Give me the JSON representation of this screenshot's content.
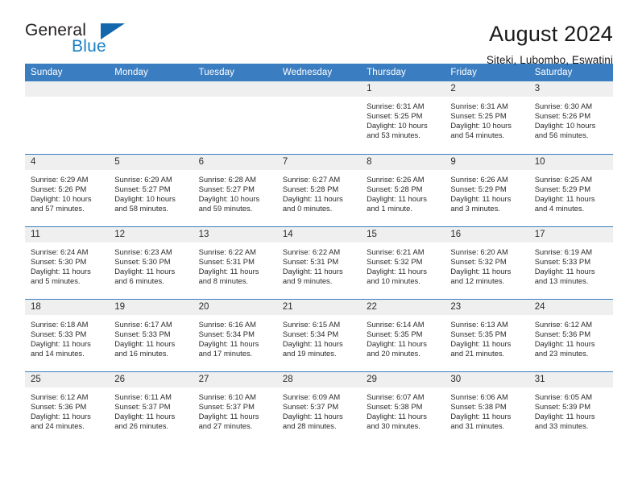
{
  "brand": {
    "word_one": "General",
    "word_two": "Blue"
  },
  "header": {
    "title": "August 2024",
    "subtitle": "Siteki, Lubombo, Eswatini"
  },
  "calendar": {
    "weekday_headers": [
      "Sunday",
      "Monday",
      "Tuesday",
      "Wednesday",
      "Thursday",
      "Friday",
      "Saturday"
    ],
    "accent_color": "#3a7dc0",
    "daynum_strip_color": "#efefef",
    "weeks": [
      [
        {
          "day": "",
          "empty": true
        },
        {
          "day": "",
          "empty": true
        },
        {
          "day": "",
          "empty": true
        },
        {
          "day": "",
          "empty": true
        },
        {
          "day": "1",
          "sunrise": "Sunrise: 6:31 AM",
          "sunset": "Sunset: 5:25 PM",
          "daylight_line1": "Daylight: 10 hours",
          "daylight_line2": "and 53 minutes."
        },
        {
          "day": "2",
          "sunrise": "Sunrise: 6:31 AM",
          "sunset": "Sunset: 5:25 PM",
          "daylight_line1": "Daylight: 10 hours",
          "daylight_line2": "and 54 minutes."
        },
        {
          "day": "3",
          "sunrise": "Sunrise: 6:30 AM",
          "sunset": "Sunset: 5:26 PM",
          "daylight_line1": "Daylight: 10 hours",
          "daylight_line2": "and 56 minutes."
        }
      ],
      [
        {
          "day": "4",
          "sunrise": "Sunrise: 6:29 AM",
          "sunset": "Sunset: 5:26 PM",
          "daylight_line1": "Daylight: 10 hours",
          "daylight_line2": "and 57 minutes."
        },
        {
          "day": "5",
          "sunrise": "Sunrise: 6:29 AM",
          "sunset": "Sunset: 5:27 PM",
          "daylight_line1": "Daylight: 10 hours",
          "daylight_line2": "and 58 minutes."
        },
        {
          "day": "6",
          "sunrise": "Sunrise: 6:28 AM",
          "sunset": "Sunset: 5:27 PM",
          "daylight_line1": "Daylight: 10 hours",
          "daylight_line2": "and 59 minutes."
        },
        {
          "day": "7",
          "sunrise": "Sunrise: 6:27 AM",
          "sunset": "Sunset: 5:28 PM",
          "daylight_line1": "Daylight: 11 hours",
          "daylight_line2": "and 0 minutes."
        },
        {
          "day": "8",
          "sunrise": "Sunrise: 6:26 AM",
          "sunset": "Sunset: 5:28 PM",
          "daylight_line1": "Daylight: 11 hours",
          "daylight_line2": "and 1 minute."
        },
        {
          "day": "9",
          "sunrise": "Sunrise: 6:26 AM",
          "sunset": "Sunset: 5:29 PM",
          "daylight_line1": "Daylight: 11 hours",
          "daylight_line2": "and 3 minutes."
        },
        {
          "day": "10",
          "sunrise": "Sunrise: 6:25 AM",
          "sunset": "Sunset: 5:29 PM",
          "daylight_line1": "Daylight: 11 hours",
          "daylight_line2": "and 4 minutes."
        }
      ],
      [
        {
          "day": "11",
          "sunrise": "Sunrise: 6:24 AM",
          "sunset": "Sunset: 5:30 PM",
          "daylight_line1": "Daylight: 11 hours",
          "daylight_line2": "and 5 minutes."
        },
        {
          "day": "12",
          "sunrise": "Sunrise: 6:23 AM",
          "sunset": "Sunset: 5:30 PM",
          "daylight_line1": "Daylight: 11 hours",
          "daylight_line2": "and 6 minutes."
        },
        {
          "day": "13",
          "sunrise": "Sunrise: 6:22 AM",
          "sunset": "Sunset: 5:31 PM",
          "daylight_line1": "Daylight: 11 hours",
          "daylight_line2": "and 8 minutes."
        },
        {
          "day": "14",
          "sunrise": "Sunrise: 6:22 AM",
          "sunset": "Sunset: 5:31 PM",
          "daylight_line1": "Daylight: 11 hours",
          "daylight_line2": "and 9 minutes."
        },
        {
          "day": "15",
          "sunrise": "Sunrise: 6:21 AM",
          "sunset": "Sunset: 5:32 PM",
          "daylight_line1": "Daylight: 11 hours",
          "daylight_line2": "and 10 minutes."
        },
        {
          "day": "16",
          "sunrise": "Sunrise: 6:20 AM",
          "sunset": "Sunset: 5:32 PM",
          "daylight_line1": "Daylight: 11 hours",
          "daylight_line2": "and 12 minutes."
        },
        {
          "day": "17",
          "sunrise": "Sunrise: 6:19 AM",
          "sunset": "Sunset: 5:33 PM",
          "daylight_line1": "Daylight: 11 hours",
          "daylight_line2": "and 13 minutes."
        }
      ],
      [
        {
          "day": "18",
          "sunrise": "Sunrise: 6:18 AM",
          "sunset": "Sunset: 5:33 PM",
          "daylight_line1": "Daylight: 11 hours",
          "daylight_line2": "and 14 minutes."
        },
        {
          "day": "19",
          "sunrise": "Sunrise: 6:17 AM",
          "sunset": "Sunset: 5:33 PM",
          "daylight_line1": "Daylight: 11 hours",
          "daylight_line2": "and 16 minutes."
        },
        {
          "day": "20",
          "sunrise": "Sunrise: 6:16 AM",
          "sunset": "Sunset: 5:34 PM",
          "daylight_line1": "Daylight: 11 hours",
          "daylight_line2": "and 17 minutes."
        },
        {
          "day": "21",
          "sunrise": "Sunrise: 6:15 AM",
          "sunset": "Sunset: 5:34 PM",
          "daylight_line1": "Daylight: 11 hours",
          "daylight_line2": "and 19 minutes."
        },
        {
          "day": "22",
          "sunrise": "Sunrise: 6:14 AM",
          "sunset": "Sunset: 5:35 PM",
          "daylight_line1": "Daylight: 11 hours",
          "daylight_line2": "and 20 minutes."
        },
        {
          "day": "23",
          "sunrise": "Sunrise: 6:13 AM",
          "sunset": "Sunset: 5:35 PM",
          "daylight_line1": "Daylight: 11 hours",
          "daylight_line2": "and 21 minutes."
        },
        {
          "day": "24",
          "sunrise": "Sunrise: 6:12 AM",
          "sunset": "Sunset: 5:36 PM",
          "daylight_line1": "Daylight: 11 hours",
          "daylight_line2": "and 23 minutes."
        }
      ],
      [
        {
          "day": "25",
          "sunrise": "Sunrise: 6:12 AM",
          "sunset": "Sunset: 5:36 PM",
          "daylight_line1": "Daylight: 11 hours",
          "daylight_line2": "and 24 minutes."
        },
        {
          "day": "26",
          "sunrise": "Sunrise: 6:11 AM",
          "sunset": "Sunset: 5:37 PM",
          "daylight_line1": "Daylight: 11 hours",
          "daylight_line2": "and 26 minutes."
        },
        {
          "day": "27",
          "sunrise": "Sunrise: 6:10 AM",
          "sunset": "Sunset: 5:37 PM",
          "daylight_line1": "Daylight: 11 hours",
          "daylight_line2": "and 27 minutes."
        },
        {
          "day": "28",
          "sunrise": "Sunrise: 6:09 AM",
          "sunset": "Sunset: 5:37 PM",
          "daylight_line1": "Daylight: 11 hours",
          "daylight_line2": "and 28 minutes."
        },
        {
          "day": "29",
          "sunrise": "Sunrise: 6:07 AM",
          "sunset": "Sunset: 5:38 PM",
          "daylight_line1": "Daylight: 11 hours",
          "daylight_line2": "and 30 minutes."
        },
        {
          "day": "30",
          "sunrise": "Sunrise: 6:06 AM",
          "sunset": "Sunset: 5:38 PM",
          "daylight_line1": "Daylight: 11 hours",
          "daylight_line2": "and 31 minutes."
        },
        {
          "day": "31",
          "sunrise": "Sunrise: 6:05 AM",
          "sunset": "Sunset: 5:39 PM",
          "daylight_line1": "Daylight: 11 hours",
          "daylight_line2": "and 33 minutes."
        }
      ]
    ]
  }
}
